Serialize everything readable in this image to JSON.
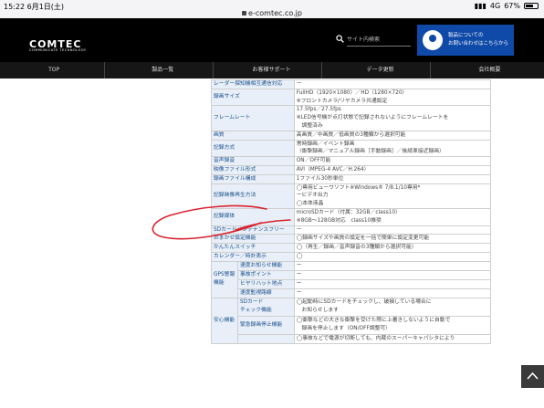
{
  "status_bar": {
    "time": "15:22",
    "date": "6月1日(土)",
    "url": "e-comtec.co.jp",
    "network": "4G",
    "battery": "67%",
    "battery_level": 0.67
  },
  "header": {
    "logo": "COMTEC",
    "logo_sub": "COMMUNICATE TECHNOLOGY",
    "search_placeholder": "サイト内検索",
    "contact_line1": "製品についての",
    "contact_line2": "お問い合わせはこちらから"
  },
  "nav": [
    "TOP",
    "製品一覧",
    "お客様サポート",
    "データ更新",
    "会社概要"
  ],
  "specs": [
    {
      "label": "レーダー探知機相互通信対応",
      "value": [
        "ー"
      ]
    },
    {
      "label": "録画サイズ",
      "value": [
        "FullHD（1920×1080）／HD（1280×720）",
        "※フロントカメラ/リヤカメラ共通設定"
      ]
    },
    {
      "label": "フレームレート",
      "value": [
        "17.5fps／27.5fps",
        "※LED信号機が点灯状態で記録されないようにフレームレートを",
        "　調整済み"
      ]
    },
    {
      "label": "画質",
      "value": [
        "高画質／中画質／低画質の3種類から選択可能"
      ]
    },
    {
      "label": "記録方式",
      "value": [
        "常時録画／イベント録画",
        "（衝撃録画／マニュアル録画［手動録画］／後続車接近録画）"
      ]
    },
    {
      "label": "音声録音",
      "value": [
        "ON／OFF可能"
      ]
    },
    {
      "label": "映像ファイル形式",
      "value": [
        "AVI（MPEG-4 AVC／H.264）"
      ]
    },
    {
      "label": "録画ファイル構成",
      "value": [
        "1ファイル30秒単位"
      ]
    },
    {
      "label": "記録映像再生方法",
      "value": [
        "◯専用ビューワソフト※Windows® 7/8.1/10専用*",
        "ービデオ出力",
        "◯本体液晶"
      ]
    },
    {
      "label": "記録媒体",
      "value": [
        "microSDカード（付属：32GB／class10）",
        "※8GB〜128GB対応　class10推奨"
      ]
    },
    {
      "label": "SDカードメンテナンスフリー",
      "value": [
        "ー"
      ]
    },
    {
      "label": "おまかせ設定機能",
      "value": [
        "◯録画サイズや画質の設定を一括で簡単に設定変更可能"
      ]
    },
    {
      "label": "かんたんスイッチ",
      "value": [
        "◯（再生／録画／音声録音の3種類から選択可能）"
      ]
    },
    {
      "label": "カレンダー／時計表示",
      "value": [
        "◯"
      ]
    }
  ],
  "gps": {
    "group_label": "GPS警報機能",
    "items": [
      {
        "label": "速度お知らせ機能",
        "value": "ー"
      },
      {
        "label": "事故ポイント",
        "value": "ー"
      },
      {
        "label": "ヒヤリハット地点",
        "value": "ー"
      },
      {
        "label": "速度監視路線",
        "value": "ー"
      }
    ]
  },
  "safety": {
    "group_label": "安心機能",
    "items": [
      {
        "label": [
          "SDカード",
          "チェック機能"
        ],
        "value": [
          "◯起動時にSDカードをチェックし、破損している場合に",
          "　お知らせします"
        ]
      },
      {
        "label": [
          "緊急録画停止機能"
        ],
        "value": [
          "◯衝撃などの大きな衝撃を受けた際に上書きしないように自動で",
          "　録画を停止します（ON/OFF調整可）"
        ]
      },
      {
        "label": [
          ""
        ],
        "value": [
          "◯事故などで電源が切断しても、内蔵のスーパーキャパシタにより"
        ]
      }
    ]
  },
  "colors": {
    "header_bg": "#000000",
    "contact_bg": "#0f4aa8",
    "label_bg": "#e8eff8",
    "label_text": "#1a4f8a",
    "annotation_red": "#d9232d"
  }
}
